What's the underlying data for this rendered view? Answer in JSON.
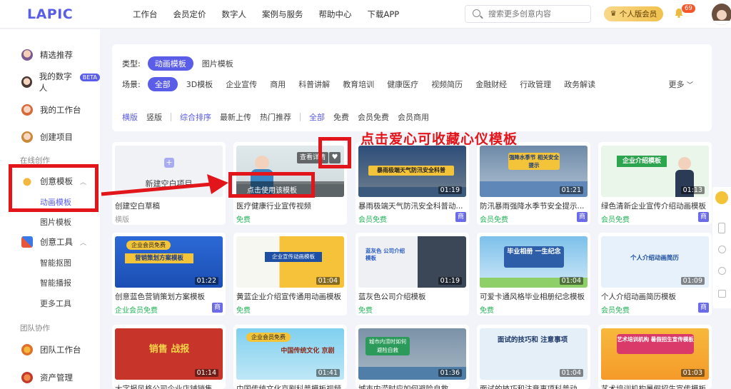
{
  "header": {
    "logo": "LAPIC",
    "nav": [
      "工作台",
      "会员定价",
      "数字人",
      "案例与服务",
      "帮助中心",
      "下载APP"
    ],
    "search_placeholder": "搜索更多创意内容",
    "member_label": "个人版会员",
    "notification_count": "69"
  },
  "sidebar": {
    "items": [
      {
        "label": "精选推荐"
      },
      {
        "label": "我的数字人",
        "badge": "BETA"
      },
      {
        "label": "我的工作台"
      },
      {
        "label": "创建项目"
      }
    ],
    "group_online": "在线创作",
    "creative_templates": "创意模板",
    "animation_templates": "动画模板",
    "image_templates": "图片模板",
    "creative_tools": "创意工具",
    "tools": [
      "智能抠图",
      "智能播报",
      "更多工具"
    ],
    "group_team": "团队协作",
    "team_workspace": "团队工作台",
    "asset_management": "资产管理"
  },
  "filters": {
    "type_label": "类型:",
    "types": [
      "动画模板",
      "图片模板"
    ],
    "scene_label": "场景:",
    "scenes": [
      "全部",
      "3D模板",
      "企业宣传",
      "商用",
      "科普讲解",
      "教育培训",
      "健康医疗",
      "视频简历",
      "金融财经",
      "行政管理",
      "政务解读"
    ],
    "more": "更多",
    "orientation": [
      "横版",
      "竖版"
    ],
    "sort": [
      "综合排序",
      "最新上传",
      "热门推荐"
    ],
    "price": [
      "全部",
      "免费",
      "会员免费",
      "会员商用"
    ]
  },
  "cards": [
    {
      "title": "创建空白草稿",
      "tag": "横版",
      "blank_label": "新建空白项目"
    },
    {
      "title": "医疗健康行业宣传视频",
      "tag": "免费",
      "hover_detail": "查看详情",
      "hover_use": "点击使用该模板"
    },
    {
      "title": "暴雨极端天气防汛安全科普动...",
      "tag": "会员免费",
      "duration": "01:19",
      "thumb_text": "暴雨极端天气防汛安全科普",
      "shang": "商"
    },
    {
      "title": "防汛暴雨强降水季节安全提示...",
      "tag": "会员免费",
      "duration": "01:21",
      "thumb_text": "强降水季节 相关安全提示",
      "shang": "商"
    },
    {
      "title": "绿色清新企业宣传介绍动画模板",
      "tag": "会员免费",
      "duration": "01:13",
      "thumb_text": "企业介绍模板",
      "shang": "商"
    },
    {
      "title": "创意蓝色营销策划方案模板",
      "tag": "企业会员免费",
      "duration": "01:22",
      "thumb_text": "营销策划方案模板",
      "thumb_badge": "企业会员免费",
      "shang": "商"
    },
    {
      "title": "黄蓝企业介绍宣传通用动画模板",
      "tag": "免费",
      "duration": "01:04",
      "thumb_text": "企业宣传动画模板"
    },
    {
      "title": "蓝灰色公司介绍模板",
      "tag": "免费",
      "duration": "01:19",
      "thumb_text": "蓝灰色 公司介绍模板"
    },
    {
      "title": "可爱卡通风格毕业相册纪念模板",
      "tag": "免费",
      "duration": "01:04",
      "thumb_text": "毕业相册 一生纪念"
    },
    {
      "title": "个人介绍动画简历模板",
      "tag": "会员免费",
      "duration": "01:09",
      "thumb_text": "个人介绍动画简历",
      "shang": "商"
    },
    {
      "title": "大字报风格公司企业店铺销售...",
      "duration": "01:14",
      "thumb_text": "销售 战报"
    },
    {
      "title": "中国传统文化京剧科普模板视频",
      "duration": "01:41",
      "thumb_text": "中国传统文化 京剧",
      "thumb_badge": "企业会员免费"
    },
    {
      "title": "城市内涝时应如何避险自救",
      "duration": "01:36",
      "thumb_text": "城市内涝时如何 避险自救"
    },
    {
      "title": "面试的技巧和注意事项科普动...",
      "duration": "01:04",
      "thumb_text": "面试的技巧和 注意事项"
    },
    {
      "title": "艺术培训机构暑假招生宣传模板",
      "duration": "01:03",
      "thumb_text": "艺术培训机构 暑假招生宣传模板"
    }
  ],
  "annotation": "点击爱心可收藏心仪模板",
  "colors": {
    "accent": "#5a5de8",
    "annotation_red": "#e2151b",
    "free_green": "#25b35a"
  }
}
